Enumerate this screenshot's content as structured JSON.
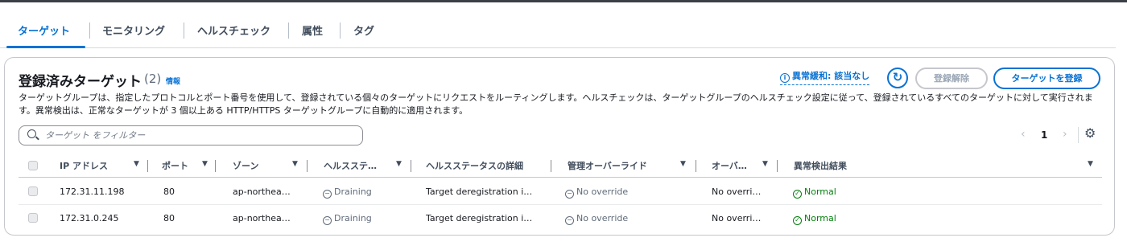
{
  "tabs": [
    {
      "label": "ターゲット"
    },
    {
      "label": "モニタリング"
    },
    {
      "label": "ヘルスチェック"
    },
    {
      "label": "属性"
    },
    {
      "label": "タグ"
    }
  ],
  "panel": {
    "title": "登録済みターゲット",
    "count": "(2)",
    "info_link": "情報",
    "description": "ターゲットグループは、指定したプロトコルとポート番号を使用して、登録されている個々のターゲットにリクエストをルーティングします。ヘルスチェックは、ターゲットグループのヘルスチェック設定に従って、登録されているすべてのターゲットに対して実行されます。異常検出は、正常なターゲットが 3 個以上ある HTTP/HTTPS ターゲットグループに自動的に適用されます。",
    "anomaly_label": "異常緩和: 該当なし",
    "deregister_button": "登録解除",
    "register_button": "ターゲットを登録"
  },
  "filter": {
    "placeholder": "ターゲット をフィルター",
    "value": ""
  },
  "pagination": {
    "prev": "‹",
    "page": "1",
    "next": "›"
  },
  "table": {
    "headers": {
      "ip": "IP アドレス",
      "port": "ポート",
      "zone": "ゾーン",
      "health": "ヘルスステ…",
      "health_detail": "ヘルスステータスの詳細",
      "override": "管理オーバーライド",
      "override2": "オーバ…",
      "anomaly": "異常検出結果"
    },
    "rows": [
      {
        "ip": "172.31.11.198",
        "port": "80",
        "zone": "ap-northea…",
        "health": "Draining",
        "health_detail": "Target deregistration i…",
        "override": "No override",
        "override2": "No overri…",
        "anomaly": "Normal"
      },
      {
        "ip": "172.31.0.245",
        "port": "80",
        "zone": "ap-northea…",
        "health": "Draining",
        "health_detail": "Target deregistration i…",
        "override": "No override",
        "override2": "No overri…",
        "anomaly": "Normal"
      }
    ]
  },
  "icons": {
    "info_circle": "info-icon",
    "refresh": "refresh-icon",
    "search": "search-icon",
    "settings": "gear-icon",
    "status_pending": "minus-circle-icon",
    "status_ok": "check-circle-icon"
  },
  "colors": {
    "accent": "#0972d3",
    "success": "#037f0c",
    "neutral": "#5f6b7a"
  }
}
